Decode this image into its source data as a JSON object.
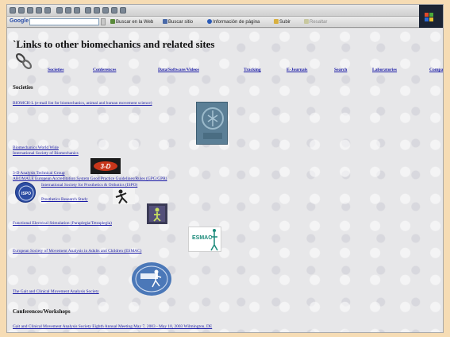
{
  "toolbar": {
    "google": "Google",
    "buttons": [
      "Buscar en la Web",
      "Buscar sitio",
      "Información de página",
      "Subir",
      "Resaltar"
    ]
  },
  "page": {
    "title": "`Links to other biomechanics and related sites",
    "nav": [
      "Societies",
      "Conferences",
      "Data/Software/Videos",
      "Tracking",
      "E-Journals",
      "Search",
      "Laboratories",
      "Compa"
    ],
    "societies_heading": "Societies",
    "societies_links": [
      "BIOMCH-L (e-mail list for biomechanics, animal and human movement science)",
      "Biomechanics World Wide",
      "International Society of Biomechanics",
      "3-D Analysis Technical Group",
      "AROMALE European Accreditation System Good Practice Guidelines/Rules (GPG/GPR)",
      "International Society for Prosthetics & Orthotics (ISPO)",
      "Prosthetics Research Study",
      "Functional Electrical Stimulation (Paraplegia/Tetraplegia)",
      "European Society of Movement Analysis in Adults and Children (ESMAC)",
      "The Gait and Clinical Movement Analysis Society"
    ],
    "conferences_heading": "Conferences/Workshops",
    "conferences_links": [
      "Gait and Clinical Movement Analysis Society Eighth Annual Meeting May 7, 2003 - May 10, 2003 Wilmington, DE"
    ],
    "logos": {
      "3d": "3-D",
      "ispo": "ISPO",
      "esmac": "ESMAC"
    }
  },
  "colors": {
    "link": "#1a1aa6",
    "background": "#e7e7e9",
    "page_border": "#f6dcb4"
  }
}
